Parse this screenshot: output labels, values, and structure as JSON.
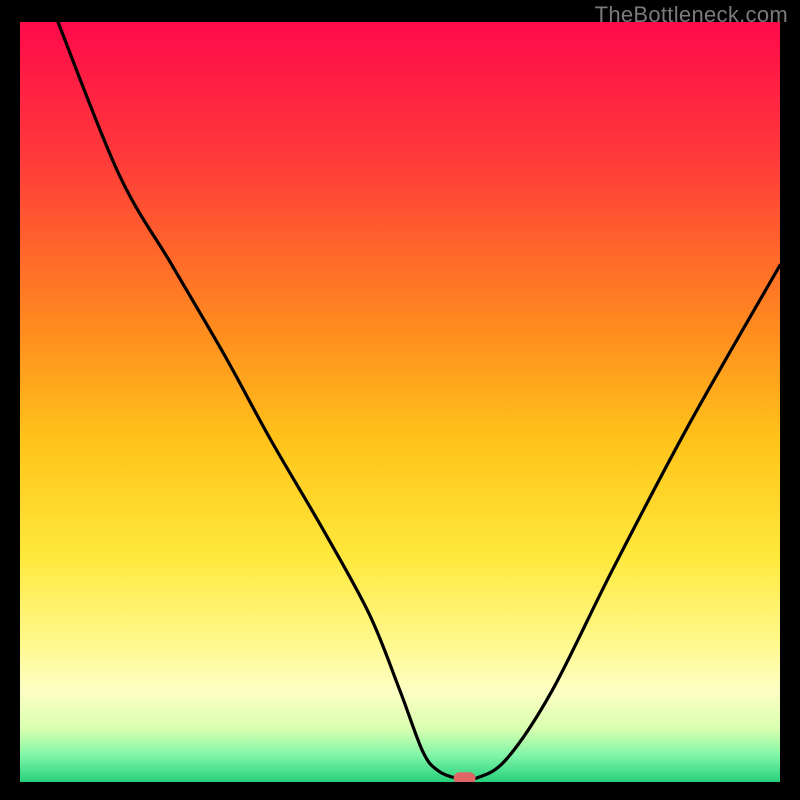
{
  "watermark": "TheBottleneck.com",
  "colors": {
    "frame": "#000000",
    "watermark_text": "#7a7a7a",
    "line": "#000000",
    "marker": "#e06666",
    "gradient_stops": [
      {
        "offset": 0.0,
        "color": "#ff0a4b"
      },
      {
        "offset": 0.18,
        "color": "#ff3a3a"
      },
      {
        "offset": 0.4,
        "color": "#ff8a1f"
      },
      {
        "offset": 0.55,
        "color": "#ffc31a"
      },
      {
        "offset": 0.7,
        "color": "#ffe83b"
      },
      {
        "offset": 0.82,
        "color": "#fff98f"
      },
      {
        "offset": 0.88,
        "color": "#fdffc4"
      },
      {
        "offset": 0.93,
        "color": "#d9ffb0"
      },
      {
        "offset": 0.965,
        "color": "#80f5a8"
      },
      {
        "offset": 1.0,
        "color": "#26d07c"
      }
    ]
  },
  "chart_data": {
    "type": "line",
    "title": "",
    "xlabel": "",
    "ylabel": "",
    "xlim": [
      0,
      100
    ],
    "ylim": [
      0,
      100
    ],
    "series": [
      {
        "name": "curve",
        "x": [
          5,
          13,
          20,
          27,
          33,
          40,
          46,
          50,
          53,
          55,
          57.5,
          60,
          64,
          70,
          78,
          88,
          100
        ],
        "values": [
          100,
          80,
          68,
          56,
          45,
          33,
          22,
          12,
          4,
          1.5,
          0.5,
          0.5,
          3,
          12,
          28,
          47,
          68
        ]
      }
    ],
    "marker": {
      "x": 58.5,
      "y": 0.5
    }
  }
}
